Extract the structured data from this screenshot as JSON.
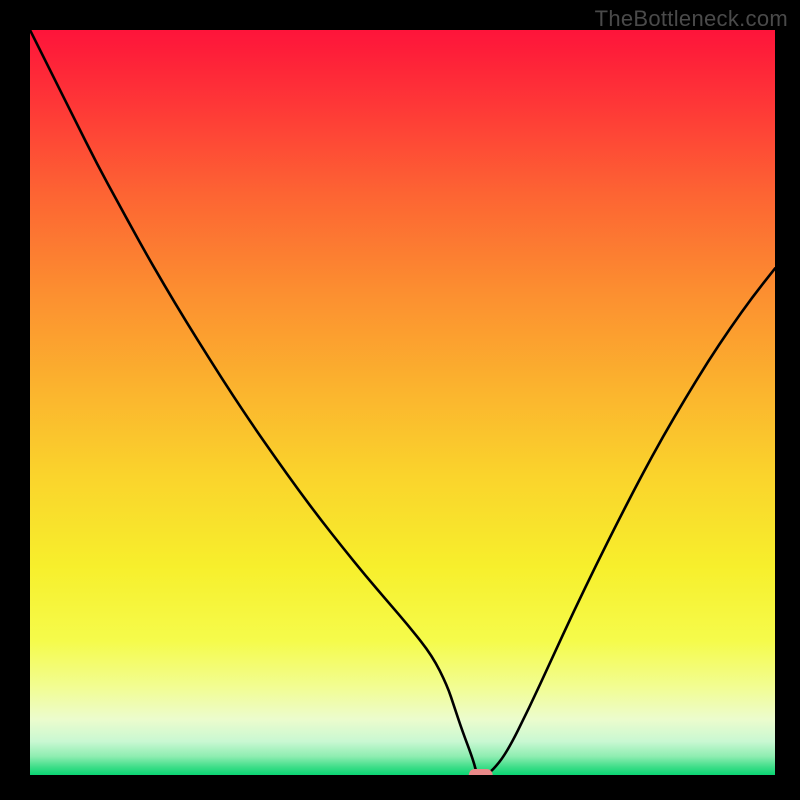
{
  "watermark": "TheBottleneck.com",
  "chart_data": {
    "type": "line",
    "title": "",
    "xlabel": "",
    "ylabel": "",
    "xlim": [
      0,
      100
    ],
    "ylim": [
      0,
      100
    ],
    "grid": false,
    "legend": false,
    "x": [
      0,
      3,
      6,
      9,
      12,
      15,
      18,
      21,
      24,
      27,
      30,
      33,
      36,
      39,
      42,
      45,
      48,
      51,
      54,
      56,
      57,
      58,
      59.5,
      60,
      61,
      62,
      64,
      67,
      70,
      73,
      76,
      79,
      82,
      85,
      88,
      91,
      94,
      97,
      100
    ],
    "y": [
      100,
      94,
      88,
      82,
      76.5,
      71,
      65.8,
      60.8,
      56,
      51.3,
      46.8,
      42.5,
      38.3,
      34.3,
      30.5,
      26.8,
      23.3,
      19.8,
      16,
      12,
      9,
      6,
      2,
      0,
      0,
      0.5,
      3,
      9,
      15.5,
      22,
      28.2,
      34.2,
      40,
      45.5,
      50.6,
      55.5,
      60,
      64.2,
      68
    ],
    "marker": {
      "x": 60.5,
      "y": 0,
      "color": "#e98989",
      "width": 3.2,
      "height": 1.6,
      "rx": 0.8
    },
    "gradient_stops": [
      {
        "offset": 0.0,
        "color": "#fe143a"
      },
      {
        "offset": 0.1,
        "color": "#fe3737"
      },
      {
        "offset": 0.22,
        "color": "#fd6433"
      },
      {
        "offset": 0.35,
        "color": "#fc8e30"
      },
      {
        "offset": 0.48,
        "color": "#fbb32e"
      },
      {
        "offset": 0.6,
        "color": "#fad42c"
      },
      {
        "offset": 0.72,
        "color": "#f7ef2c"
      },
      {
        "offset": 0.82,
        "color": "#f5fb4b"
      },
      {
        "offset": 0.88,
        "color": "#f2fd90"
      },
      {
        "offset": 0.925,
        "color": "#ecfccd"
      },
      {
        "offset": 0.955,
        "color": "#c9f8d2"
      },
      {
        "offset": 0.975,
        "color": "#8eedb1"
      },
      {
        "offset": 0.99,
        "color": "#3add87"
      },
      {
        "offset": 1.0,
        "color": "#0ad573"
      }
    ]
  }
}
